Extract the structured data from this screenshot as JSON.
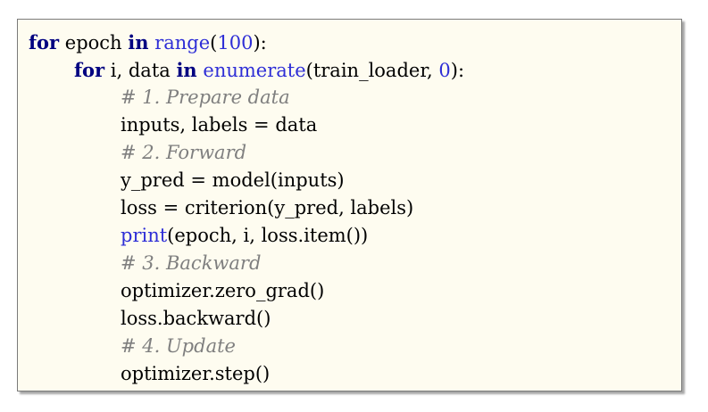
{
  "code": {
    "line1": {
      "kw1": "for",
      "var": " epoch ",
      "kw2": "in",
      "sp": " ",
      "fn": "range",
      "open": "(",
      "num": "100",
      "close": "):"
    },
    "line2": {
      "kw1": "for",
      "var": " i, data ",
      "kw2": "in",
      "sp": " ",
      "fn": "enumerate",
      "args": "(train_loader, ",
      "num": "0",
      "close": "):"
    },
    "line3": "# 1. Prepare data",
    "line4": "inputs, labels = data",
    "line5": "# 2. Forward",
    "line6": "y_pred = model(inputs)",
    "line7": "loss = criterion(y_pred, labels)",
    "line8": {
      "fn": "print",
      "args": "(epoch, i, loss.item())"
    },
    "line9": "# 3. Backward",
    "line10": "optimizer.zero_grad()",
    "line11": "loss.backward()",
    "line12": "# 4. Update",
    "line13": "optimizer.step()"
  },
  "colors": {
    "background": "#fefcf0",
    "keyword": "#000080",
    "builtin": "#2e2ed6",
    "comment": "#7f7f7f"
  }
}
